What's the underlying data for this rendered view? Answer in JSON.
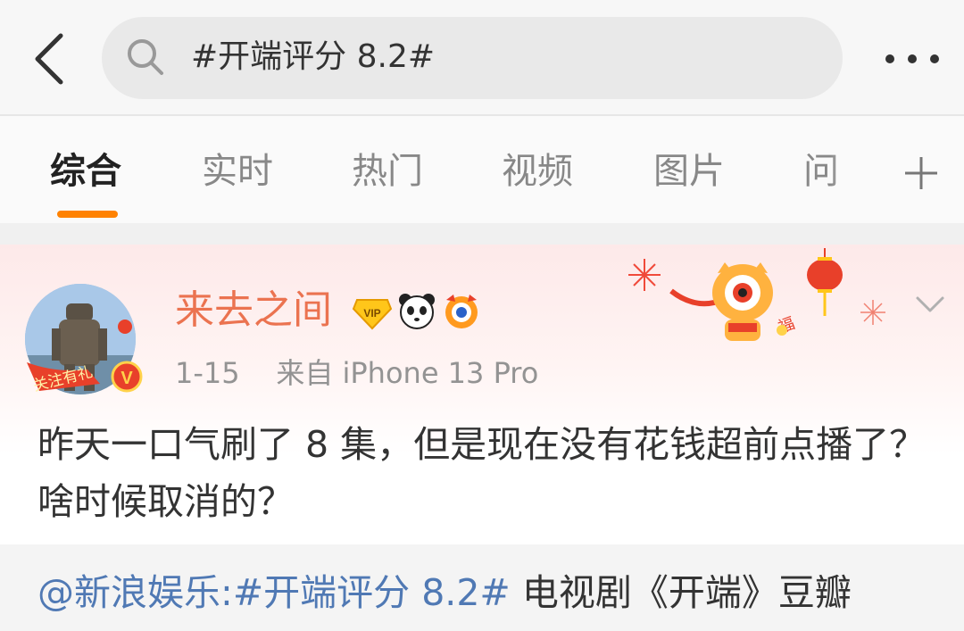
{
  "header": {
    "search_query": "#开端评分 8.2#"
  },
  "tabs": [
    {
      "label": "综合",
      "active": true
    },
    {
      "label": "实时"
    },
    {
      "label": "热门"
    },
    {
      "label": "视频"
    },
    {
      "label": "图片"
    },
    {
      "label": "问"
    }
  ],
  "post": {
    "username": "来去之间",
    "avatar_badge_text": "关注有礼",
    "badges": [
      "vip-icon",
      "panda-icon",
      "tiger-medal-icon"
    ],
    "timestamp": "1-15",
    "source": "来自 iPhone 13 Pro",
    "text": "昨天一口气刷了 8 集，但是现在没有花钱超前点播了？啥时候取消的？"
  },
  "repost": {
    "mention": "@新浪娱乐",
    "colon": ":",
    "hashtag": "#开端评分 8.2#",
    "rest": " 电视剧《开端》豆瓣"
  },
  "colors": {
    "accent": "#ff8200",
    "username": "#eb7350",
    "link": "#5079b4"
  }
}
